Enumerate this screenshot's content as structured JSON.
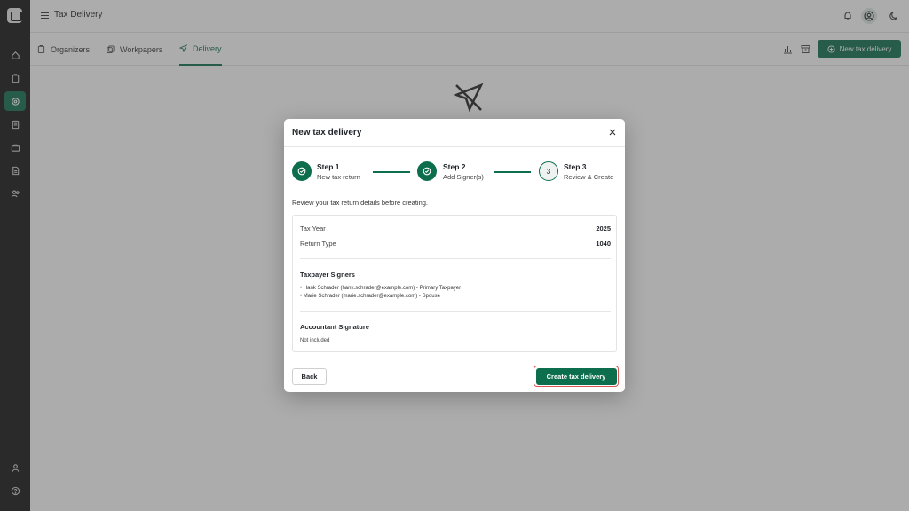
{
  "app": {
    "title": "Tax Delivery"
  },
  "rail": {
    "items": [
      "home-icon",
      "organizer-icon",
      "delivery-icon",
      "document-icon",
      "briefcase-icon",
      "file-icon",
      "users-icon",
      "user-icon",
      "help-icon"
    ]
  },
  "tabs": [
    {
      "label": "Organizers",
      "icon": "clipboard-icon"
    },
    {
      "label": "Workpapers",
      "icon": "copy-icon"
    },
    {
      "label": "Delivery",
      "icon": "send-icon",
      "active": true
    }
  ],
  "toolbar": {
    "new_label": "New tax delivery"
  },
  "modal": {
    "title": "New tax delivery",
    "steps": [
      {
        "name": "Step 1",
        "sub": "New tax return",
        "state": "done"
      },
      {
        "name": "Step 2",
        "sub": "Add Signer(s)",
        "state": "done"
      },
      {
        "name": "Step 3",
        "sub": "Review & Create",
        "state": "current",
        "number": "3"
      }
    ],
    "review_note": "Review your tax return details before creating.",
    "details": {
      "tax_year_label": "Tax Year",
      "tax_year": "2025",
      "return_type_label": "Return Type",
      "return_type": "1040"
    },
    "signers": {
      "title": "Taxpayer Signers",
      "items": [
        "• Hank Schrader (hank.schrader@example.com) - Primary Taxpayer",
        "• Marie Schrader (marie.schrader@example.com) - Spouse"
      ]
    },
    "accountant": {
      "title": "Accountant Signature",
      "value": "Not included"
    },
    "back_label": "Back",
    "create_label": "Create tax delivery"
  },
  "colors": {
    "brand": "#0d6e4d",
    "highlight": "#d9534f"
  }
}
